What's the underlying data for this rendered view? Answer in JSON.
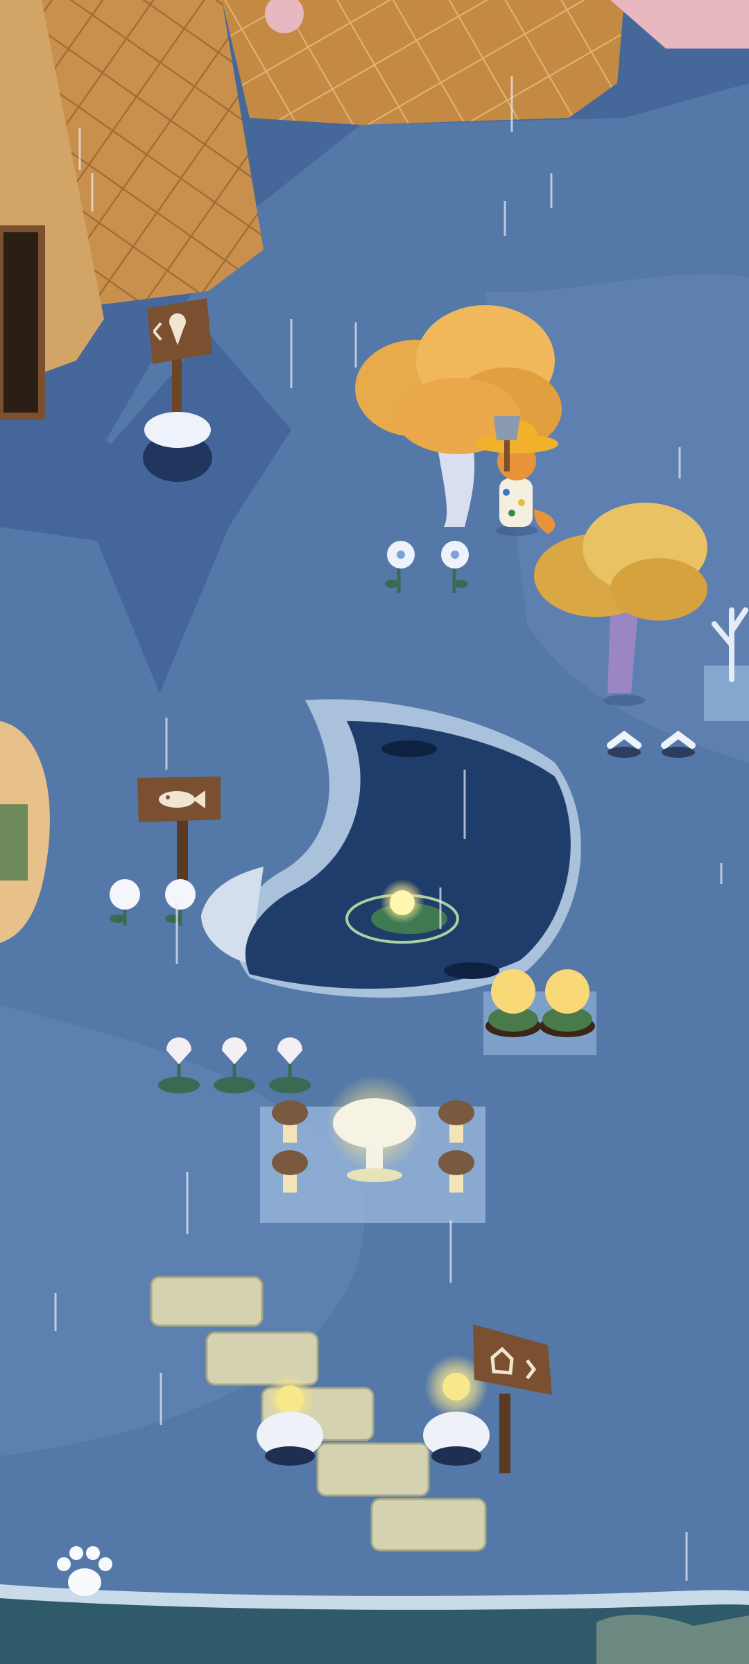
{
  "scene": "rainy-garden",
  "colors": {
    "ground": "#5478a8",
    "ground_light": "#6a8cbb",
    "cliff_shadow": "#4a6a98",
    "pond_water": "#1f3d6a",
    "pond_rim": "#a9c1da",
    "tree_gold": "#e8ab4c",
    "tree_gold_light": "#f3c266",
    "trunk_white": "#d9dff0",
    "trunk_purple": "#9a86c2",
    "ice_cream_cone": "#c8904c",
    "sign_wood": "#7a5030",
    "sea": "#2f5a6a",
    "foam": "#c9dbe8"
  },
  "icons": {
    "fish_sign": "fish-icon",
    "ice_cream_sign": "ice-cream-icon",
    "home_sign": "home-icon",
    "paw_button": "paw-icon",
    "player_tool": "axe-icon"
  },
  "objects": {
    "player": "fox-character",
    "lanterns": 4,
    "tulips": 3,
    "white_flowers": 2,
    "blue_flowers": 2
  }
}
